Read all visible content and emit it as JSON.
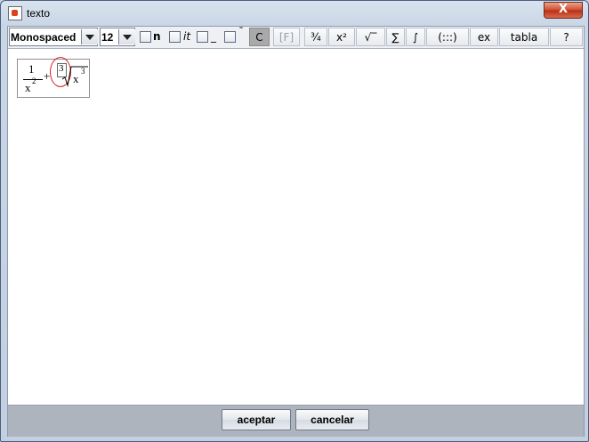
{
  "window": {
    "title": "texto",
    "close_label": "X"
  },
  "toolbar": {
    "font_family": "Monospaced",
    "font_size": "12",
    "bold_label": "n",
    "italic_label": "it",
    "underline_label": "_",
    "overline_label": "¯",
    "color_label": "C",
    "formula_label": "[F]",
    "fraction_label": "¾",
    "power_label": "x²",
    "root_label": "√‾",
    "sum_label": "∑",
    "integral_label": "∫",
    "matrix_label": "(:::)",
    "ex_label": "ex",
    "table_label": "tabla",
    "help_label": "?"
  },
  "formula": {
    "numerator": "1",
    "denominator_base": "x",
    "denominator_exp": "2",
    "plus": "+",
    "root_index": "3",
    "radicand_base": "x",
    "radicand_exp": "3"
  },
  "buttons": {
    "accept": "aceptar",
    "cancel": "cancelar"
  },
  "colors": {
    "highlight_circle": "#d51f1f",
    "pressed_button": "#a9a9a9",
    "bottom_bar": "#aeb4be"
  }
}
